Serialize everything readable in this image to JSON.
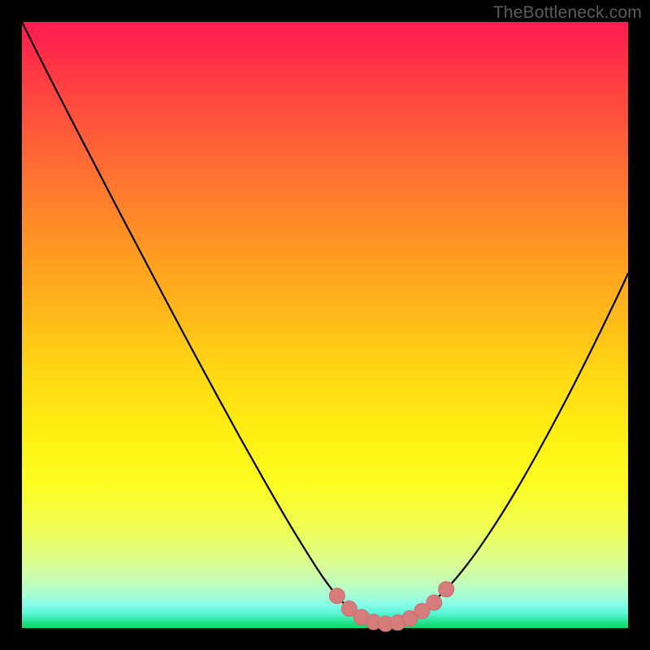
{
  "watermark": "TheBottleneck.com",
  "colors": {
    "curve": "#000000",
    "marker_fill": "#d77c7c",
    "marker_stroke": "#c86e6e"
  },
  "chart_data": {
    "type": "line",
    "title": "",
    "xlabel": "",
    "ylabel": "",
    "xlim": [
      0,
      100
    ],
    "ylim": [
      0,
      100
    ],
    "grid": false,
    "series": [
      {
        "name": "bottleneck-curve",
        "x": [
          0,
          4,
          8,
          12,
          16,
          20,
          24,
          28,
          32,
          36,
          40,
          44,
          48,
          50,
          52,
          54,
          56,
          58,
          60,
          62,
          64,
          66,
          70,
          74,
          78,
          82,
          86,
          90,
          94,
          98,
          100
        ],
        "y": [
          100,
          92,
          84.2,
          76.5,
          68.8,
          61.2,
          53.6,
          46.1,
          38.7,
          31.4,
          24.3,
          17.4,
          10.9,
          7.9,
          5.3,
          3.2,
          1.8,
          1.0,
          0.7,
          0.9,
          1.6,
          2.8,
          6.4,
          11.2,
          17.0,
          23.5,
          30.6,
          38.1,
          46.0,
          54.2,
          58.5
        ]
      }
    ],
    "markers": {
      "name": "highlight-dots",
      "x": [
        52,
        54,
        56,
        58,
        60,
        62,
        64,
        66,
        68,
        70
      ],
      "y": [
        5.3,
        3.2,
        1.8,
        1.0,
        0.7,
        0.9,
        1.6,
        2.8,
        4.2,
        6.4
      ]
    }
  }
}
